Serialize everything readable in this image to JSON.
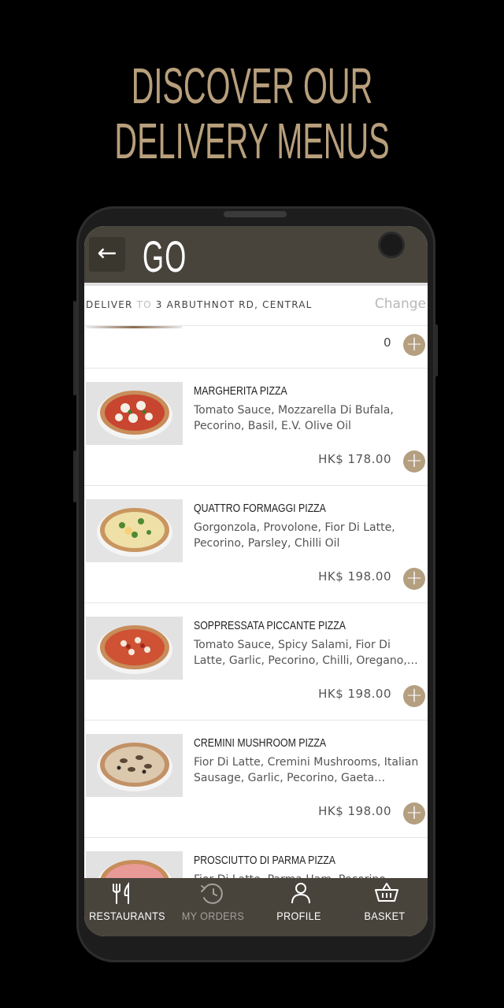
{
  "promo": {
    "line1": "DISCOVER OUR",
    "line2": "DELIVERY MENUS"
  },
  "header": {
    "logo": "GO",
    "back_icon": "←"
  },
  "delivery": {
    "prefix": "DELIVER",
    "to": "TO",
    "address": "3 ARBUTHNOT RD, CENTRAL",
    "change_label": "Change"
  },
  "partial_item": {
    "quantity": "0"
  },
  "menu": {
    "items": [
      {
        "name": "MARGHERITA PIZZA",
        "description": "Tomato Sauce, Mozzarella Di Bufala, Pecorino, Basil, E.V. Olive Oil",
        "price": "HK$ 178.00"
      },
      {
        "name": "QUATTRO FORMAGGI PIZZA",
        "description": "Gorgonzola, Provolone, Fior Di Latte, Pecorino, Parsley, Chilli Oil",
        "price": "HK$ 198.00"
      },
      {
        "name": "SOPPRESSATA PICCANTE PIZZA",
        "description": "Tomato Sauce, Spicy Salami, Fior Di Latte, Garlic, Pecorino, Chilli, Oregano, E.V. Olive…",
        "price": "HK$ 198.00"
      },
      {
        "name": "CREMINI MUSHROOM PIZZA",
        "description": "Fior Di Latte, Cremini Mushrooms, Italian Sausage, Garlic, Pecorino, Gaeta Olives,…",
        "price": "HK$ 198.00"
      },
      {
        "name": "PROSCIUTTO DI PARMA PIZZA",
        "description": "Fior Di Latte, Parma Ham, Pecorino",
        "price": ""
      }
    ],
    "add_symbol": "+"
  },
  "nav": {
    "restaurants": "RESTAURANTS",
    "my_orders": "MY ORDERS",
    "profile": "PROFILE",
    "basket": "BASKET"
  },
  "colors": {
    "accent": "#b49f80",
    "headline": "#b89f7c",
    "bar": "#48443b"
  },
  "icons": [
    "arrow-left-icon",
    "plus-icon",
    "fork-knife-icon",
    "clock-history-icon",
    "person-icon",
    "basket-icon"
  ]
}
